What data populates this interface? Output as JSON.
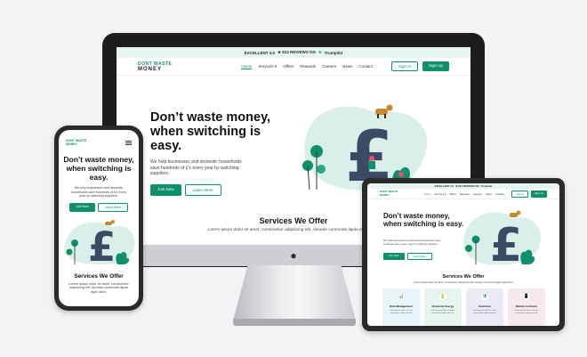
{
  "colors": {
    "brand": "#0f8f6a",
    "trust": "#00b67a",
    "blob": "#d8f0e9",
    "pound": "#3c4a66",
    "tablet_card_1": "#e8f5f8",
    "tablet_card_2": "#e6f6ef",
    "tablet_card_3": "#ece9f7",
    "tablet_card_4": "#f6e8ef"
  },
  "topbar": {
    "text": "EXCELLENT 4.5",
    "reviews": "★ 813 REVIEWS ON",
    "brand": "Trustpilot"
  },
  "logo": {
    "line1": "DONT WASTE",
    "line2": "MONEY"
  },
  "nav": {
    "items": [
      "Home",
      "Services ▾",
      "Offers",
      "Rewards",
      "Careers",
      "News",
      "Contact"
    ]
  },
  "auth": {
    "signin": "Sign In",
    "signup": "Sign Up"
  },
  "hero": {
    "title": "Don’t waste money, when switching is easy.",
    "text": "We help businesses and domestic households save hundreds of £’s every year by switching suppliers.",
    "join": "Join Now",
    "learn": "Learn More"
  },
  "services": {
    "title": "Services We Offer",
    "text": "Lorem ipsum dolor sit amet, consectetur adipiscing elit. Aenean commodo ligula eget dolor."
  },
  "tablet_cards": [
    {
      "title": "Debt Management",
      "desc": "Lorem ipsum dolor sit amet, consectetur adipiscing elit.",
      "icon": "📊"
    },
    {
      "title": "Domestic Energy",
      "desc": "Lorem ipsum dolor sit amet, consectetur adipiscing elit.",
      "icon": "💡"
    },
    {
      "title": "Insurance",
      "desc": "Lorem ipsum dolor sit amet, consectetur adipiscing elit.",
      "icon": "🛡"
    },
    {
      "title": "Mobile Contracts",
      "desc": "Lorem ipsum dolor sit amet, consectetur adipiscing elit.",
      "icon": "📱"
    }
  ],
  "apple": ""
}
